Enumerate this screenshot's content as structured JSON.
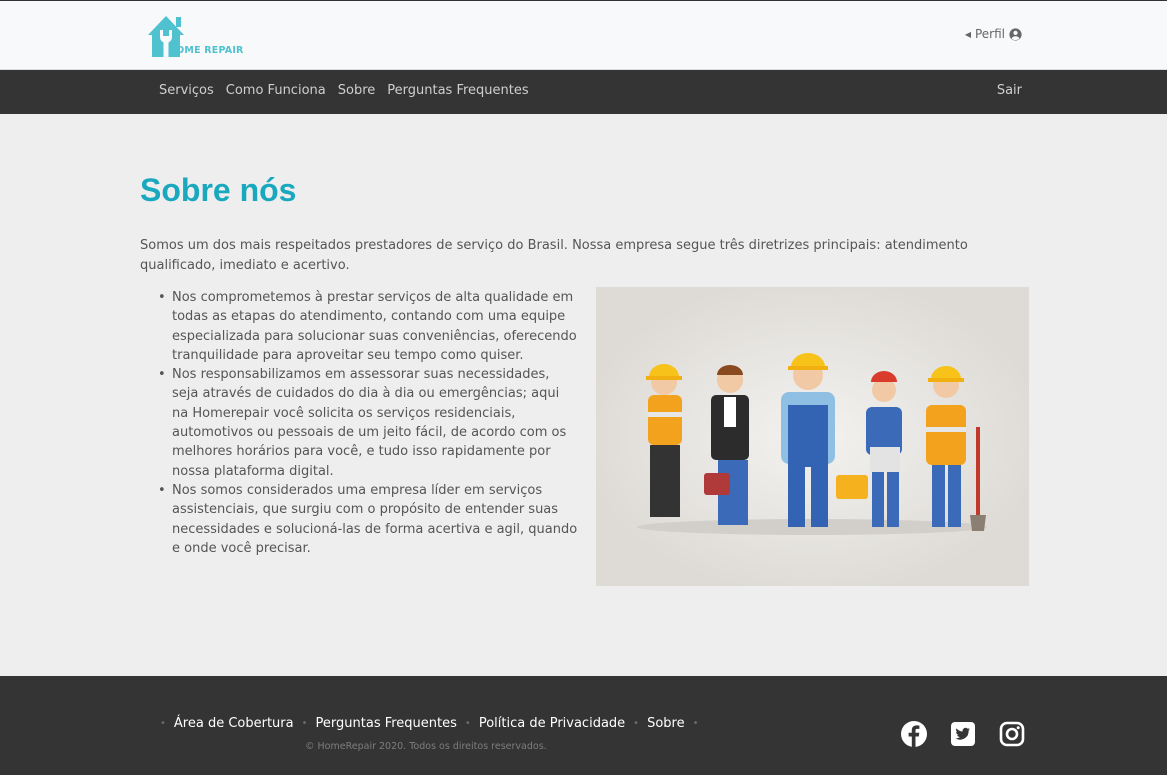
{
  "header": {
    "logo_text": "HOME REPAIR",
    "perfil_label": "Perfil"
  },
  "nav": {
    "items": [
      "Serviços",
      "Como Funciona",
      "Sobre",
      "Perguntas Frequentes"
    ],
    "sair_label": "Sair"
  },
  "main": {
    "title": "Sobre nós",
    "intro": "Somos um dos mais respeitados prestadores de serviço do Brasil. Nossa empresa segue três diretrizes principais: atendimento qualificado, imediato e acertivo.",
    "bullets": [
      "Nos comprometemos à prestar serviços de alta qualidade em todas as etapas do atendimento, contando com uma equipe especializada para solucionar suas conveniências, oferecendo tranquilidade para aproveitar seu tempo como quiser.",
      "Nos responsabilizamos em assessorar suas necessidades, seja através de cuidados do dia à dia ou emergências; aqui na Homerepair você solicita os serviços residenciais, automotivos ou pessoais de um jeito fácil, de acordo com os melhores horários para você, e tudo isso rapidamente por nossa plataforma digital.",
      "Nos somos considerados uma empresa líder em serviços assistenciais, que surgiu com o propósito de entender suas necessidades e solucioná-las de forma acertiva e agil, quando e onde você precisar."
    ]
  },
  "footer": {
    "links": [
      "Área de Cobertura",
      "Perguntas Frequentes",
      "Política de Privacidade",
      "Sobre"
    ],
    "copyright": "© HomeRepair 2020. Todos os direitos reservados.",
    "social_icons": [
      "facebook-icon",
      "twitter-icon",
      "instagram-icon"
    ]
  },
  "colors": {
    "accent": "#1aa8bf",
    "logo": "#4fc1cf",
    "nav_bg": "#343434",
    "page_bg": "#eeeeee"
  }
}
